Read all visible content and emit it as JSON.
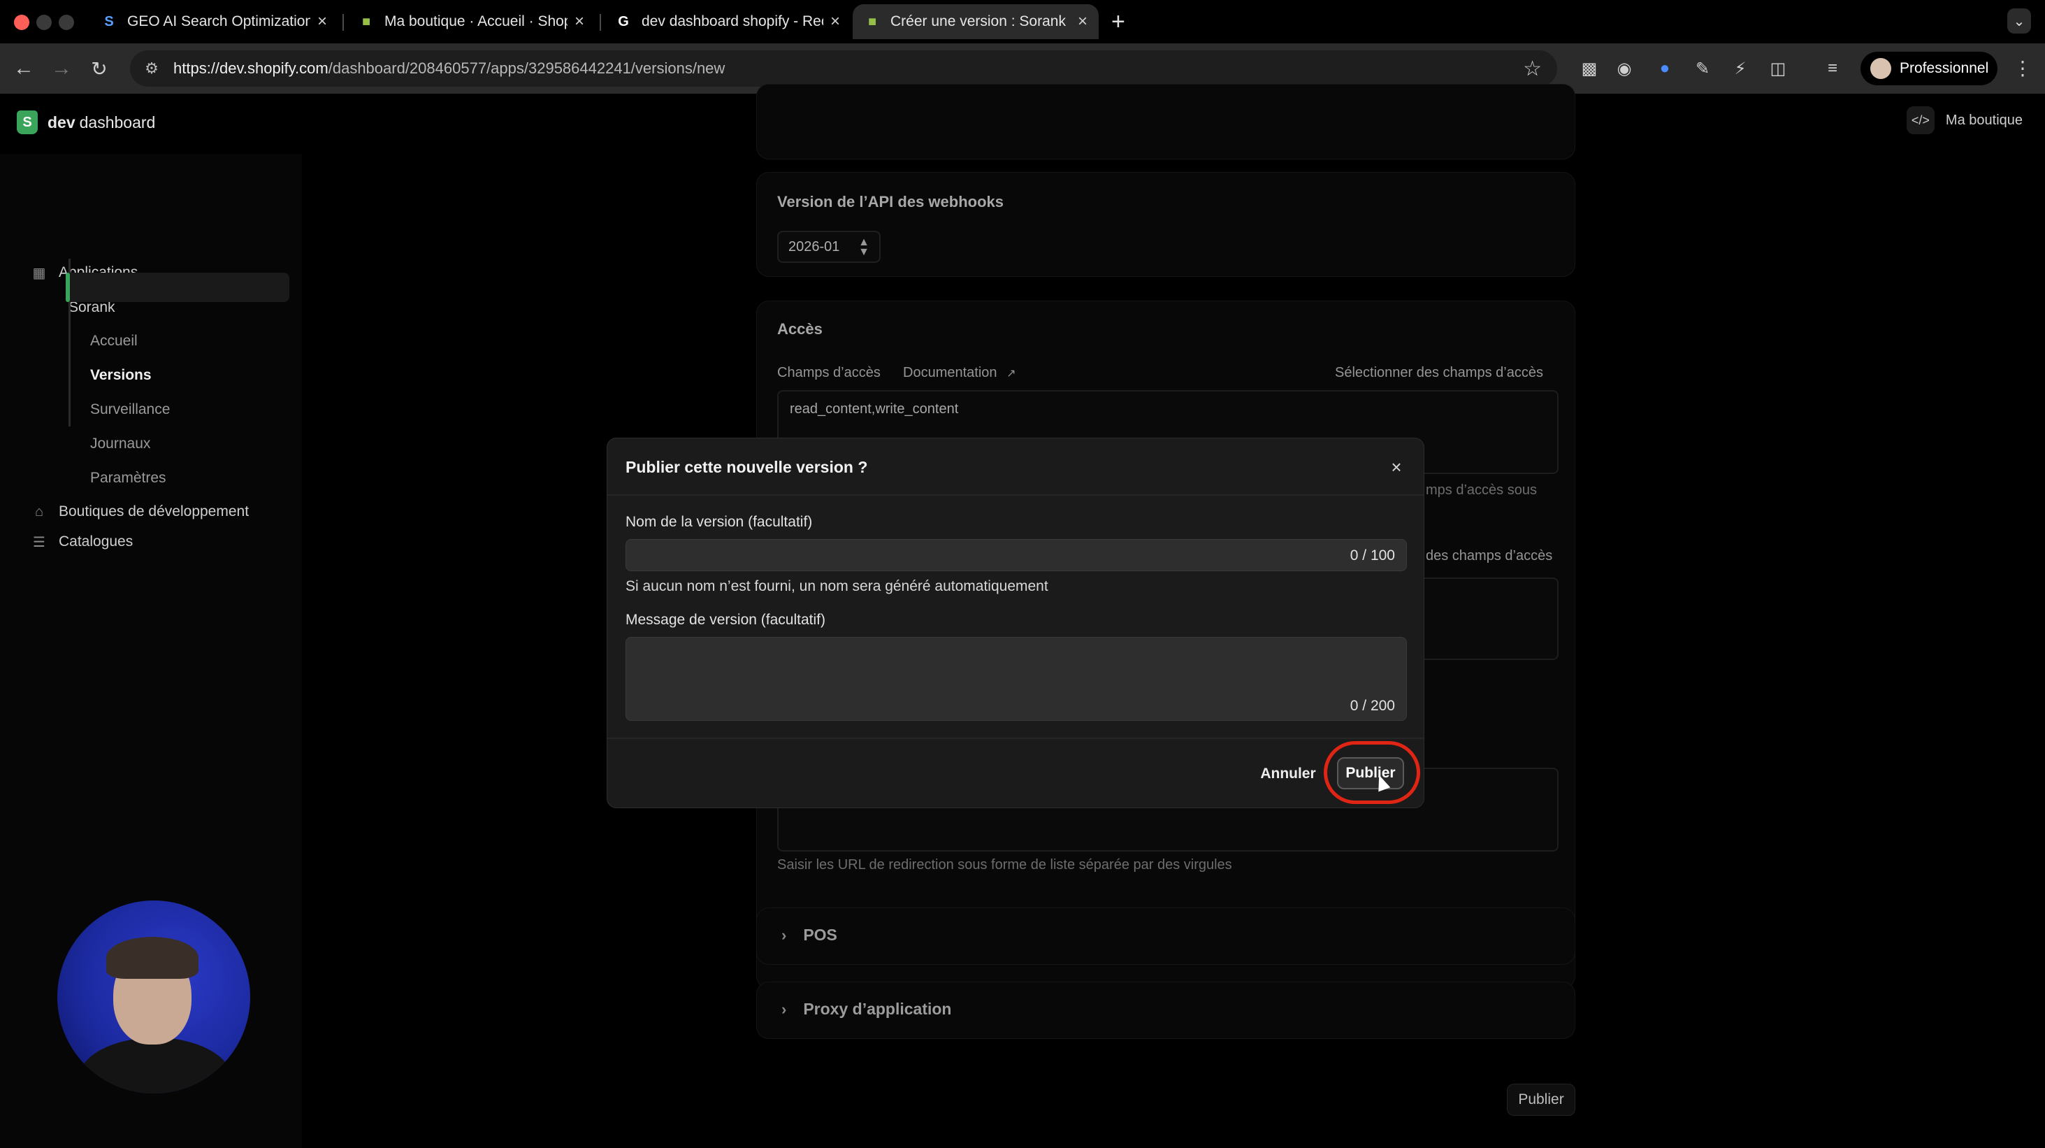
{
  "browser": {
    "tabs": [
      {
        "title": "GEO AI Search Optimization S",
        "favicon": "s-logo-icon"
      },
      {
        "title": "Ma boutique · Accueil · Shopi",
        "favicon": "shopify-bag-icon"
      },
      {
        "title": "dev dashboard shopify - Rech",
        "favicon": "google-icon"
      },
      {
        "title": "Créer une version : Sorank",
        "favicon": "shopify-bag-icon",
        "active": true
      }
    ],
    "url_host": "https://dev.shopify.com",
    "url_path": "/dashboard/208460577/apps/329586442241/versions/new",
    "profile_label": "Professionnel"
  },
  "app": {
    "brand_dev": "dev",
    "brand_dashboard": "dashboard",
    "shop_button": "Ma boutique"
  },
  "sidebar": {
    "applications": "Applications",
    "app_name": "Sorank",
    "items": [
      "Accueil",
      "Versions",
      "Surveillance",
      "Journaux",
      "Paramètres"
    ],
    "active": "Versions",
    "dev_stores": "Boutiques de développement",
    "catalogs": "Catalogues"
  },
  "main": {
    "webhooks_api_label": "Version de l’API des webhooks",
    "webhooks_api_value": "2026-01",
    "access_title": "Accès",
    "scopes_label": "Champs d’accès",
    "documentation_link": "Documentation",
    "select_scopes": "Sélectionner des champs d’accès",
    "scopes_value": "read_content,write_content",
    "scopes_partial": "mps d’accès sous",
    "scopes_partial_2": "des champs d’accès",
    "redirect_help": "Saisir les URL de redirection sous forme de liste séparée par des virgules",
    "pos_label": "POS",
    "proxy_label": "Proxy d’application",
    "publish_bottom": "Publier"
  },
  "modal": {
    "title": "Publier cette nouvelle version ?",
    "name_label": "Nom de la version (facultatif)",
    "name_value": "",
    "name_count": "0 / 100",
    "name_help": "Si aucun nom n’est fourni, un nom sera généré automatiquement",
    "message_label": "Message de version (facultatif)",
    "message_value": "",
    "message_count": "0 / 200",
    "cancel": "Annuler",
    "publish": "Publier"
  },
  "colors": {
    "accent_green": "#3aa55a",
    "highlight_ring": "#e02515"
  }
}
